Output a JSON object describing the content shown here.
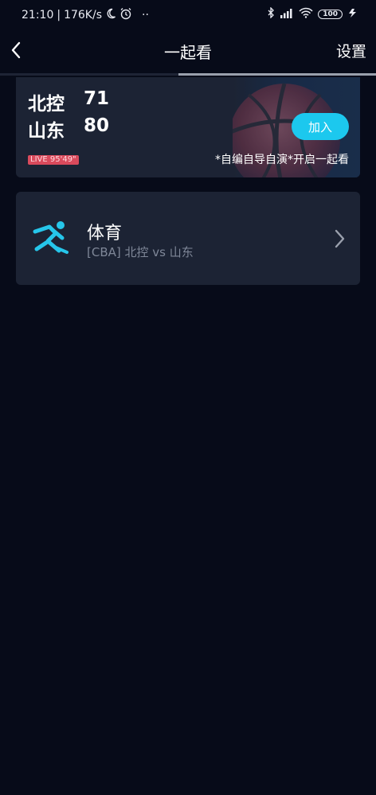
{
  "status_bar": {
    "time": "21:10",
    "speed": "176K/s",
    "more": "··",
    "battery": "100",
    "icons": [
      "moon-icon",
      "alarm-icon",
      "bluetooth-icon",
      "signal-icon",
      "wifi-icon",
      "battery-icon",
      "charging-icon"
    ]
  },
  "nav": {
    "title": "一起看",
    "settings_label": "设置",
    "back_icon": "chevron-left-icon"
  },
  "match": {
    "team1": {
      "name": "北控",
      "score": "71"
    },
    "team2": {
      "name": "山东",
      "score": "80"
    },
    "live_label": "LIVE 95'49\"",
    "join_label": "加入",
    "tagline": "*自编自导自演*开启一起看"
  },
  "sports_item": {
    "title": "体育",
    "subtitle": "[CBA] 北控 vs 山东",
    "icon": "running-person-icon",
    "chevron": "chevron-right-icon"
  },
  "colors": {
    "background": "#070b19",
    "card": "#1c2334",
    "accent": "#1cc8ee",
    "live_badge": "#d94a5c",
    "muted_text": "#7f8798"
  }
}
